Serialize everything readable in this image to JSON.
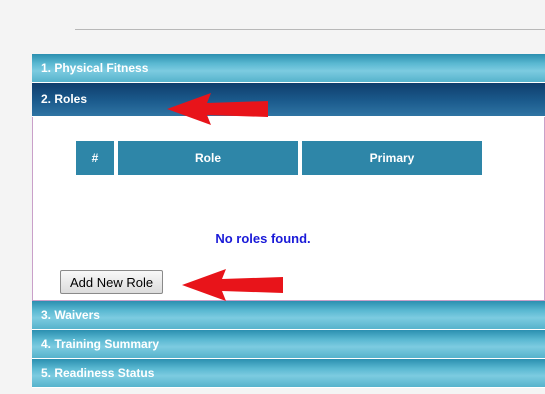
{
  "accordion": {
    "sections": [
      {
        "label": "1. Physical Fitness"
      },
      {
        "label": "2. Roles"
      },
      {
        "label": "3. Waivers"
      },
      {
        "label": "4. Training Summary"
      },
      {
        "label": "5. Readiness Status"
      }
    ]
  },
  "roles_table": {
    "headers": [
      "#",
      "Role",
      "Primary"
    ],
    "empty_message": "No roles found."
  },
  "add_role_button": {
    "label": "Add New Role"
  },
  "colors": {
    "active_header": "#1b5b8d",
    "inactive_header": "#5bb9d2",
    "table_header": "#2e86a8",
    "empty_message": "#1a1ad8",
    "annotation_arrow": "#e8141a"
  },
  "icons": {
    "annotation": "red-arrow-icon"
  }
}
